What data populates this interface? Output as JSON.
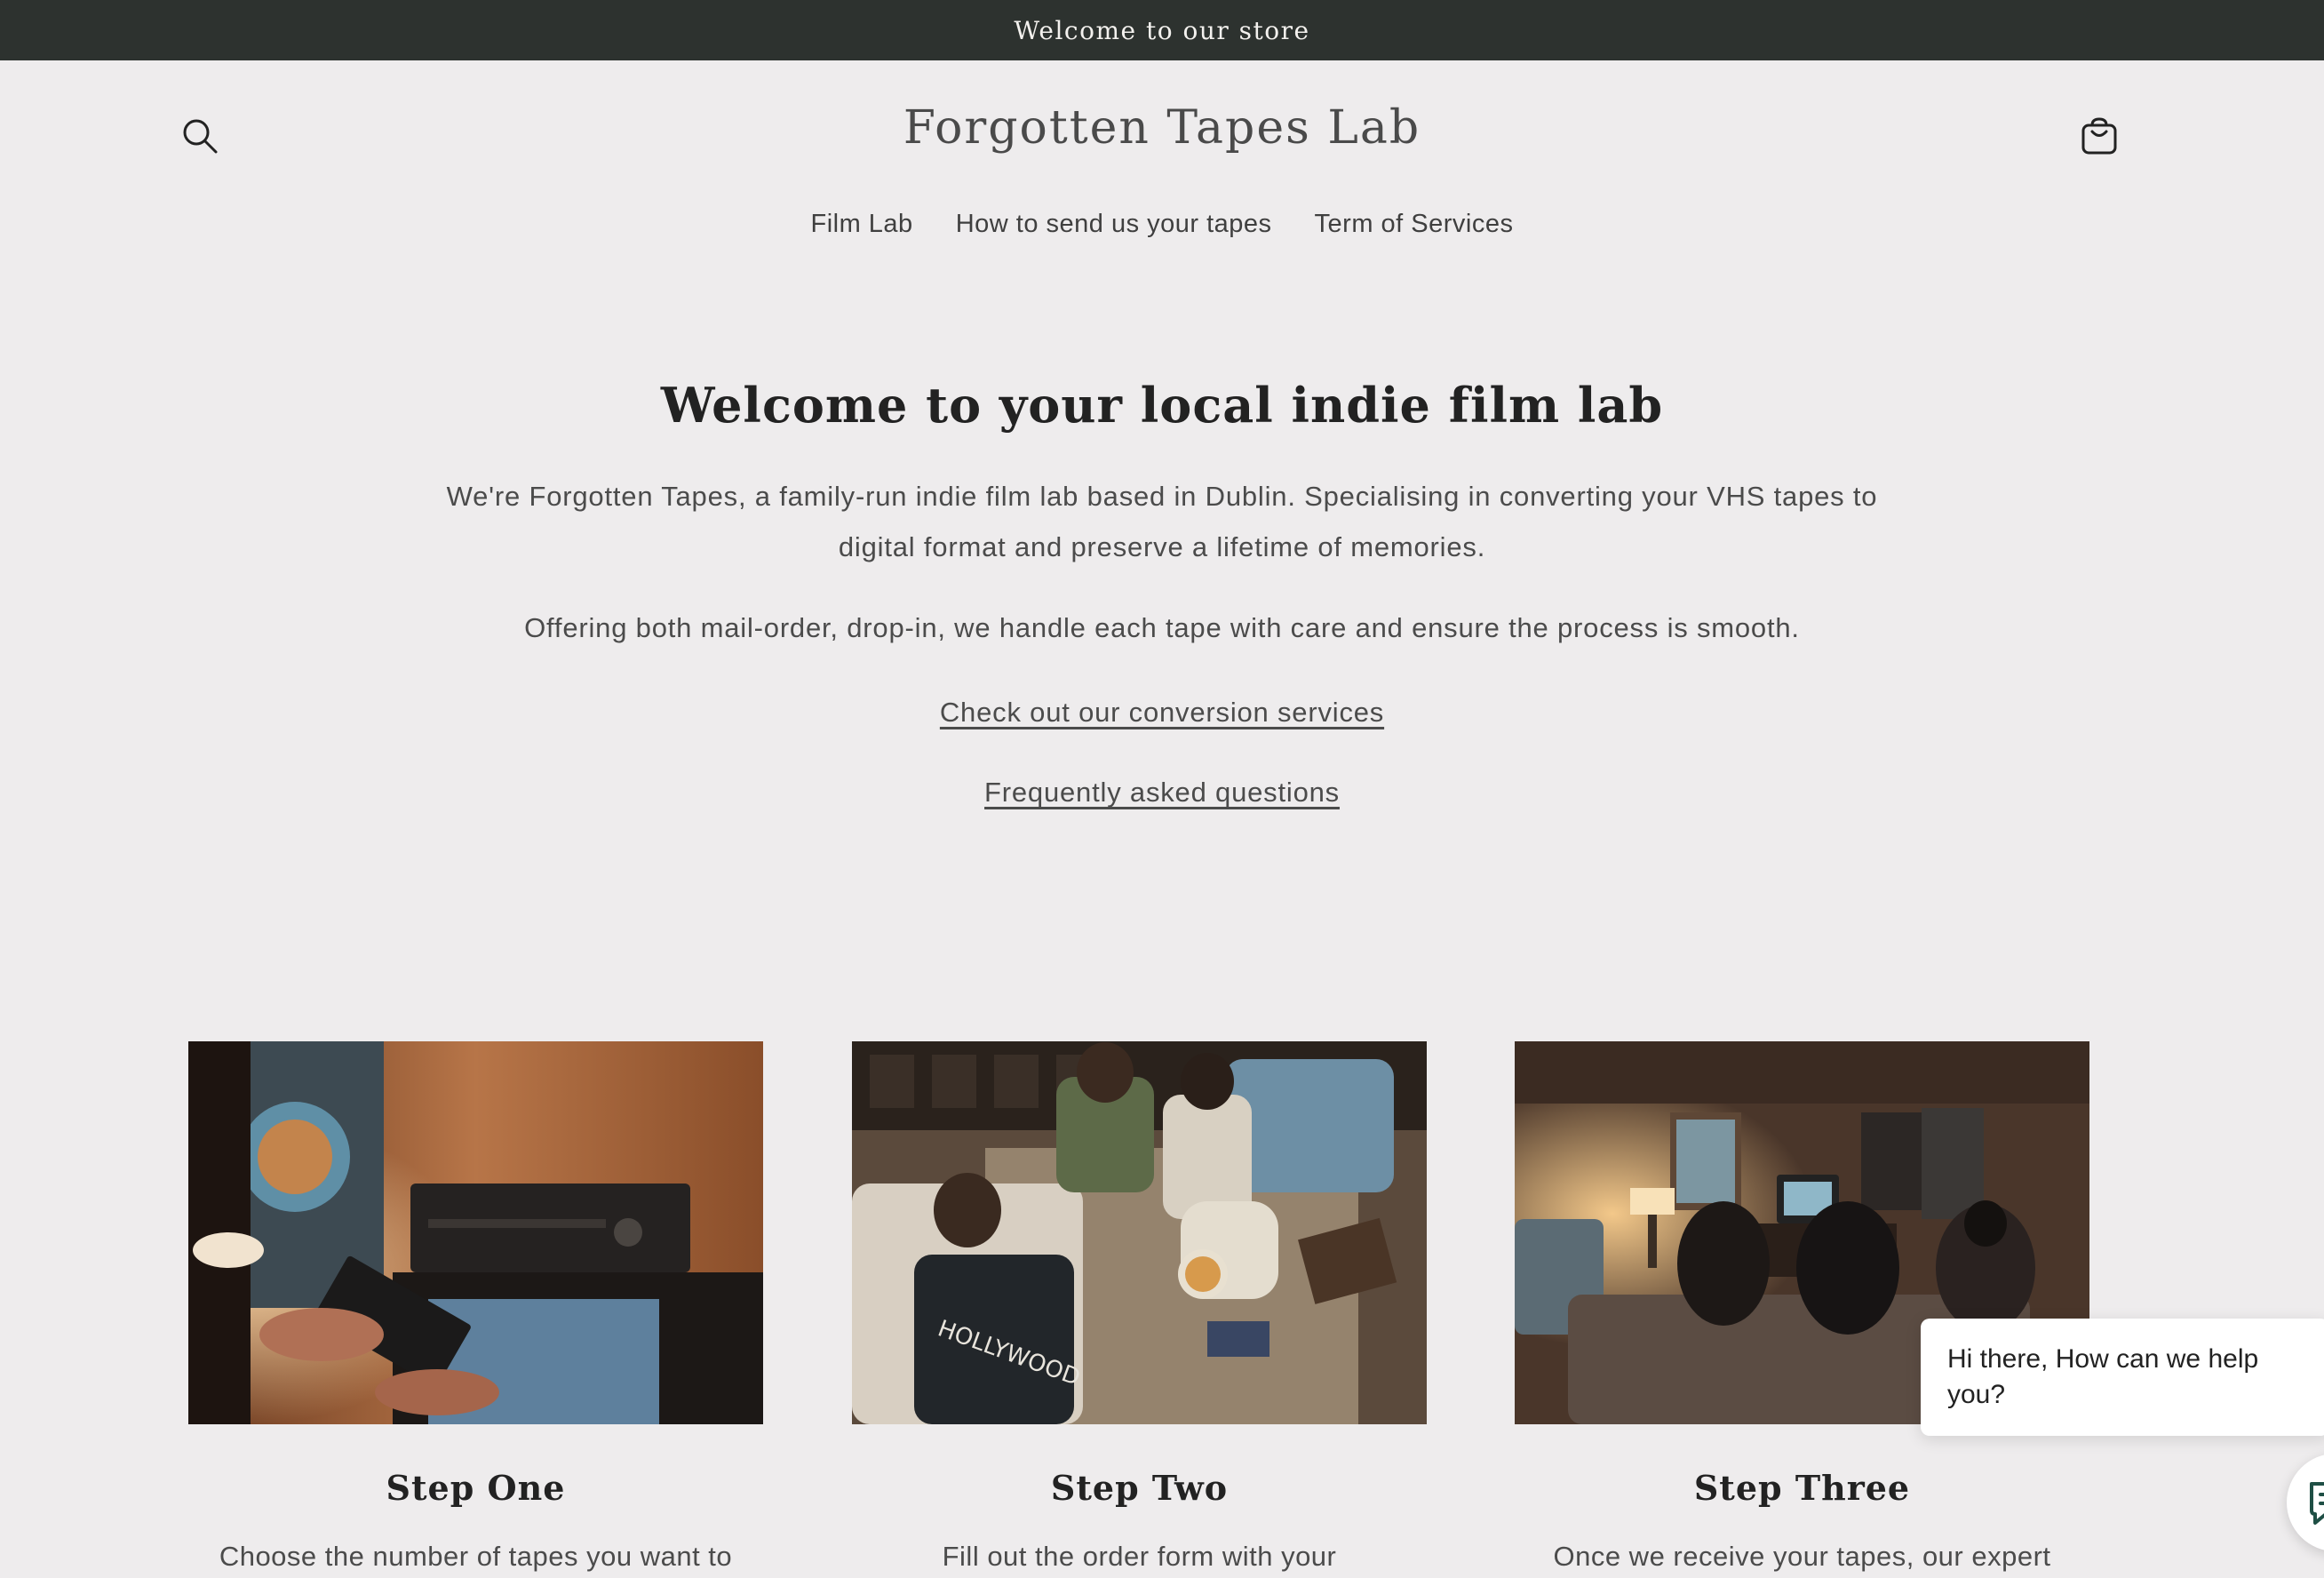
{
  "announcement": {
    "text": "Welcome to our store"
  },
  "header": {
    "brand": "Forgotten Tapes Lab",
    "search_icon": "search-icon",
    "cart_icon": "cart-icon"
  },
  "nav": {
    "items": [
      {
        "label": "Film Lab"
      },
      {
        "label": "How to send us your tapes"
      },
      {
        "label": "Term of Services"
      }
    ]
  },
  "hero": {
    "title": "Welcome to your local indie film lab",
    "paragraph_1": "We're Forgotten Tapes, a family-run indie film lab based in Dublin. Specialising in converting your VHS tapes to digital format and preserve a lifetime of memories.",
    "paragraph_2": "Offering both mail-order, drop-in, we handle each tape with care and ensure the process is smooth.",
    "link_services": "Check out our conversion services",
    "link_faq": "Frequently asked questions"
  },
  "steps": [
    {
      "title": "Step One",
      "text": "Choose the number of tapes you want to"
    },
    {
      "title": "Step Two",
      "text": "Fill out the order form with your"
    },
    {
      "title": "Step Three",
      "text": "Once we receive your tapes, our expert"
    }
  ],
  "chat": {
    "greeting": "Hi there, How can we help you?",
    "launcher_icon": "chat-icon"
  },
  "colors": {
    "page_background": "#eeeced",
    "announcement_background": "#2d322f",
    "chat_accent": "#1f4f45"
  }
}
